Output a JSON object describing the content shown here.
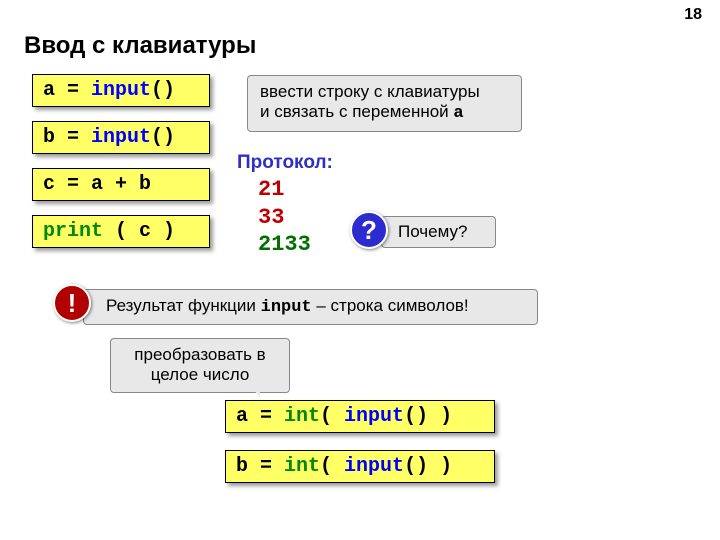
{
  "page_number": "18",
  "title": "Ввод с клавиатуры",
  "codeboxes": {
    "a_input": {
      "plain1": "a = ",
      "kw": "input",
      "plain2": "()"
    },
    "b_input": {
      "plain1": "b = ",
      "kw": "input",
      "plain2": "()"
    },
    "c_assign": {
      "plain": "c = a + b"
    },
    "print_c": {
      "fn": "print",
      "plain": " ( c )"
    },
    "a_int": {
      "plain1": "a = ",
      "fn": "int",
      "plain2": "( ",
      "kw": "input",
      "plain3": "() )"
    },
    "b_int": {
      "plain1": "b = ",
      "fn": "int",
      "plain2": "( ",
      "kw": "input",
      "plain3": "() )"
    }
  },
  "callouts": {
    "input_expl_l1": "ввести строку с клавиатуры",
    "input_expl_l2a": "и связать с переменной ",
    "input_expl_l2b": "a",
    "why": "Почему?",
    "result_l1a": "Результат функции ",
    "result_l1b": "input",
    "result_l1c": " – строка символов!",
    "convert_l1": "преобразовать в",
    "convert_l2": "целое число"
  },
  "protocol": {
    "label": "Протокол:",
    "line1": "21",
    "line2": "33",
    "line3": "2133"
  },
  "badges": {
    "question": "?",
    "exclaim": "!"
  }
}
